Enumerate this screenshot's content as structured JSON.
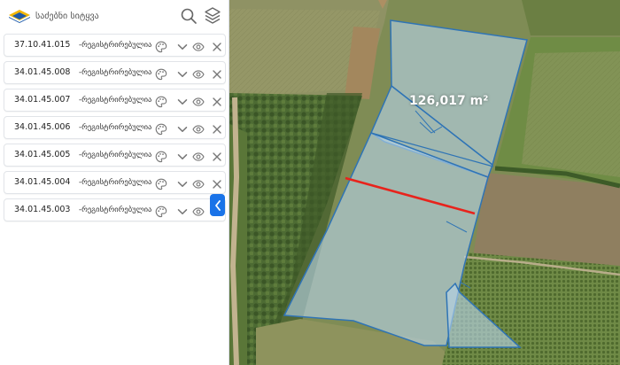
{
  "search": {
    "placeholder": "საძებნი სიტყვა"
  },
  "parcels": [
    {
      "code": "37.10.41.015",
      "status": "-რეგისტრირებულია"
    },
    {
      "code": "34.01.45.008",
      "status": "-რეგისტრირებულია"
    },
    {
      "code": "34.01.45.007",
      "status": "-რეგისტრირებულია"
    },
    {
      "code": "34.01.45.006",
      "status": "-რეგისტრირებულია"
    },
    {
      "code": "34.01.45.005",
      "status": "-რეგისტრირებულია"
    },
    {
      "code": "34.01.45.004",
      "status": "-რეგისტრირებულია"
    },
    {
      "code": "34.01.45.003",
      "status": "-რეგისტრირებულია"
    }
  ],
  "row_icons": [
    "palette-icon",
    "chevron-down-icon",
    "eye-icon",
    "close-icon"
  ],
  "map": {
    "area_label": "126,017 m²",
    "parcel_outline_color": "#2f74b5",
    "measure_line_color": "#e8231c"
  },
  "colors": {
    "accent": "#1a73e8"
  }
}
